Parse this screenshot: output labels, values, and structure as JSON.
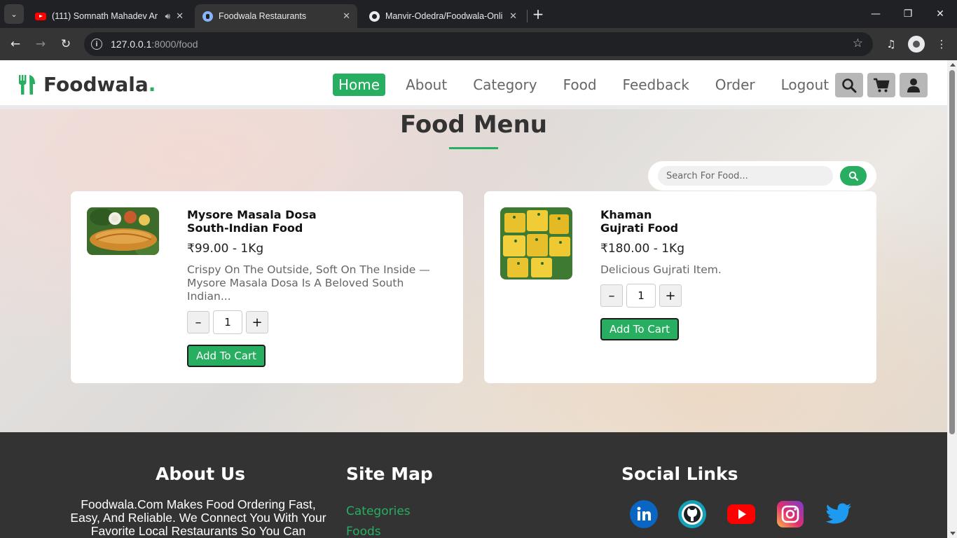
{
  "browser": {
    "tabs": [
      {
        "title": "(111) Somnath Mahadev Ar",
        "favicon": "youtube-icon",
        "audio": true,
        "active": false
      },
      {
        "title": "Foodwala Restaurants",
        "favicon": "site-icon",
        "audio": false,
        "active": true
      },
      {
        "title": "Manvir-Odedra/Foodwala-Onli",
        "favicon": "github-icon",
        "audio": false,
        "active": false
      }
    ],
    "url_host": "127.0.0.1",
    "url_path": ":8000/food"
  },
  "site": {
    "logo_text": "Foodwala",
    "logo_dot": ".",
    "nav": [
      {
        "label": "Home",
        "active": true
      },
      {
        "label": "About",
        "active": false
      },
      {
        "label": "Category",
        "active": false
      },
      {
        "label": "Food",
        "active": false
      },
      {
        "label": "Feedback",
        "active": false
      },
      {
        "label": "Order",
        "active": false
      },
      {
        "label": "Logout",
        "active": false
      }
    ],
    "accent": "#27ae60"
  },
  "menu": {
    "title": "Food Menu",
    "search_placeholder": "Search For Food...",
    "items": [
      {
        "name": "Mysore Masala Dosa",
        "category": "South-Indian Food",
        "price": "₹99.00 - 1Kg",
        "description": "Crispy On The Outside, Soft On The Inside — Mysore Masala Dosa Is A Beloved South Indian...",
        "quantity": "1",
        "button": "Add To Cart"
      },
      {
        "name": "Khaman",
        "category": "Gujrati Food",
        "price": "₹180.00 - 1Kg",
        "description": "Delicious Gujrati Item.",
        "quantity": "1",
        "button": "Add To Cart"
      }
    ],
    "qty_minus": "–",
    "qty_plus": "+"
  },
  "footer": {
    "about_title": "About Us",
    "about_text": "Foodwala.Com Makes Food Ordering Fast, Easy, And Reliable. We Connect You With Your Favorite Local Restaurants So You Can",
    "sitemap_title": "Site Map",
    "sitemap_links": [
      "Categories",
      "Foods"
    ],
    "social_title": "Social Links",
    "social": [
      "linkedin-icon",
      "github-icon",
      "youtube-icon",
      "instagram-icon",
      "twitter-icon"
    ]
  }
}
